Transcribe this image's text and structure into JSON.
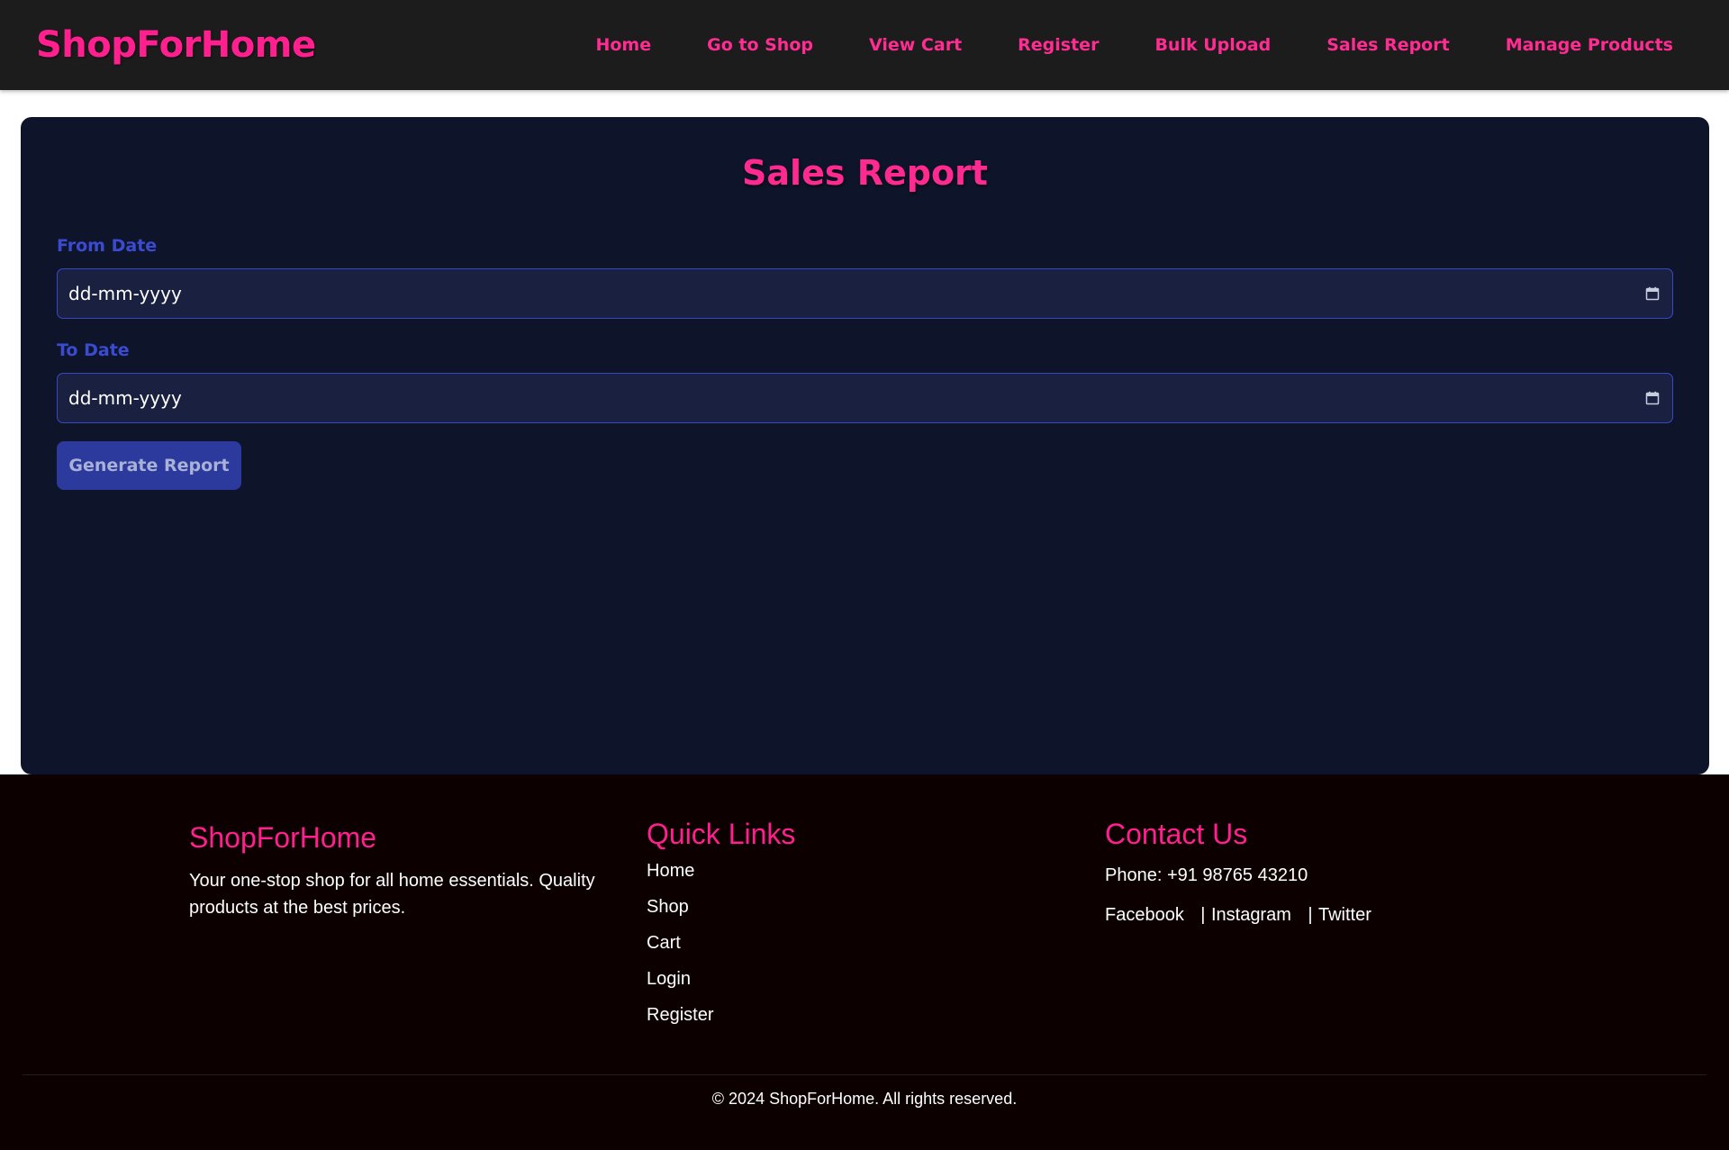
{
  "navbar": {
    "brand": "ShopForHome",
    "links": [
      "Home",
      "Go to Shop",
      "View Cart",
      "Register",
      "Bulk Upload",
      "Sales Report",
      "Manage Products"
    ]
  },
  "report": {
    "title": "Sales Report",
    "from_label": "From Date",
    "from_value": "dd-mm-yyyy",
    "to_label": "To Date",
    "to_value": "dd-mm-yyyy",
    "calendar_icon": "calendar-icon",
    "button_label": "Generate Report"
  },
  "footer": {
    "about": {
      "title": "ShopForHome",
      "text": "Your one-stop shop for all home essentials. Quality products at the best prices."
    },
    "quick_links": {
      "title": "Quick Links",
      "items": [
        "Home",
        "Shop",
        "Cart",
        "Login",
        "Register"
      ]
    },
    "contact": {
      "title": "Contact Us",
      "phone": "Phone: +91 98765 43210",
      "socials": [
        "Facebook",
        "Instagram",
        "Twitter"
      ],
      "separator": "|"
    },
    "copyright": "© 2024 ShopForHome. All rights reserved."
  },
  "colors": {
    "accent": "#ff1f8f",
    "navbar_bg": "#1c1c1c",
    "card_bg": "#0e152a",
    "label": "#3b4bd1",
    "button_bg": "#2b3a9c",
    "footer_bg": "#0c0000"
  }
}
